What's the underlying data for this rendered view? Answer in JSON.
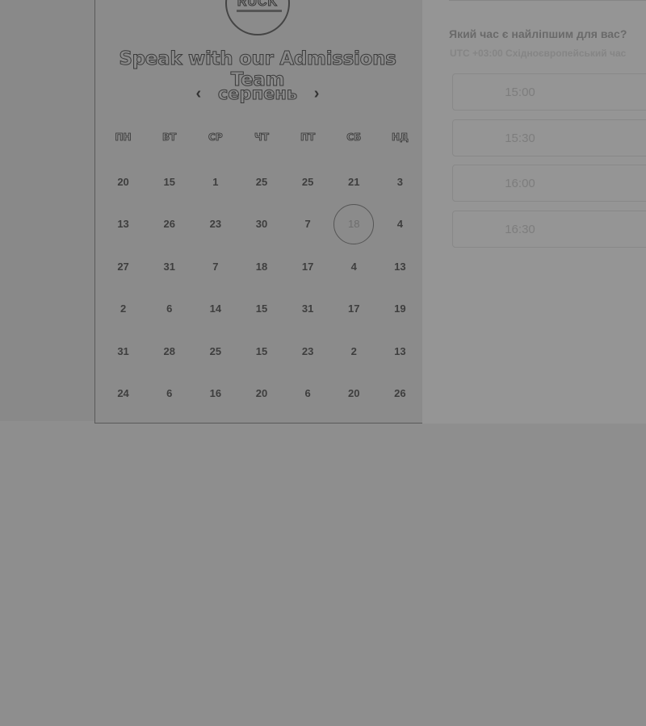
{
  "calendar": {
    "logo_text": "RUCK",
    "title": "Speak with our Admissions Team",
    "month": "серпень",
    "prev_icon": "chevron-left-icon",
    "next_icon": "chevron-right-icon",
    "weekdays": [
      "ПН",
      "ВТ",
      "СР",
      "ЧТ",
      "ПТ",
      "СБ",
      "НД"
    ],
    "weeks": [
      [
        "20",
        "15",
        "1",
        "25",
        "25",
        "21",
        "3"
      ],
      [
        "13",
        "26",
        "23",
        "30",
        "7",
        "18",
        "4"
      ],
      [
        "27",
        "31",
        "7",
        "18",
        "17",
        "4",
        "13"
      ],
      [
        "2",
        "6",
        "14",
        "15",
        "31",
        "17",
        "19"
      ],
      [
        "31",
        "28",
        "25",
        "15",
        "23",
        "2",
        "13"
      ],
      [
        "24",
        "6",
        "16",
        "20",
        "6",
        "20",
        "26"
      ]
    ],
    "selected_day": "18"
  },
  "times": {
    "question": "Який час є найліпшим для вас?",
    "timezone": "UTC +03:00 Східноєвропейський час",
    "slots": [
      "15:00",
      "15:30",
      "16:00",
      "16:30"
    ]
  }
}
